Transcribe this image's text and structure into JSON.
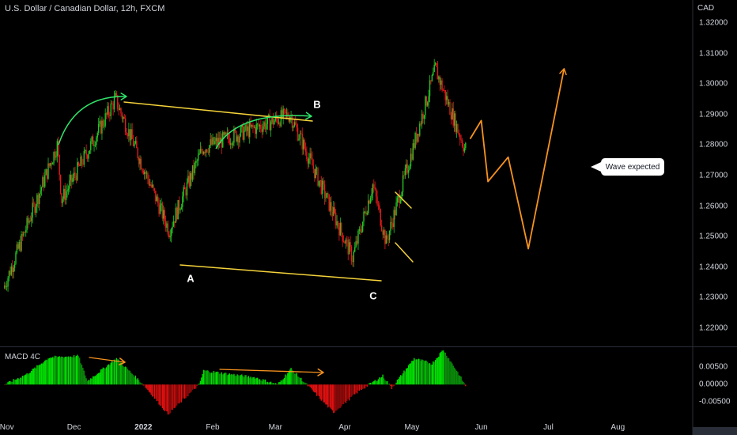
{
  "header": {
    "title": "U.S. Dollar / Canadian Dollar, 12h, FXCM",
    "currency": "CAD"
  },
  "indicator": {
    "title": "MACD 4C"
  },
  "annotations": {
    "a": "A",
    "b": "B",
    "c": "C",
    "callout": "Wave expected"
  },
  "colors": {
    "up": "#26c426",
    "down": "#e51a1a",
    "ann_yellow": "#f5d33a",
    "ann_green": "#2fe56b",
    "ann_orange": "#f7931e",
    "macd_up_bright": "#00e000",
    "macd_up_dark": "#0a8a0a",
    "macd_down_bright": "#e01010",
    "macd_down_dark": "#8a0a0a"
  },
  "chart_data": [
    {
      "type": "candlestick",
      "symbol": "USDCAD",
      "timeframe": "12h",
      "ylim": [
        1.214,
        1.3275
      ],
      "yticks": [
        "1.32000",
        "1.31000",
        "1.30000",
        "1.29000",
        "1.28000",
        "1.27000",
        "1.26000",
        "1.25000",
        "1.24000",
        "1.23000",
        "1.22000"
      ],
      "xticks": [
        "Nov",
        "Dec",
        "2022",
        "Feb",
        "Mar",
        "Apr",
        "May",
        "Jun",
        "Jul",
        "Aug"
      ],
      "xticks_bold": [
        "2022"
      ],
      "key_points": [
        {
          "x": "Oct 31, 2021",
          "y": 1.233
        },
        {
          "x": "Nov 24, 2021",
          "y": 1.28
        },
        {
          "x": "Nov 26, 2021",
          "y": 1.262
        },
        {
          "x": "Dec 20, 2021",
          "y": 1.295
        },
        {
          "x": "Jan 13, 2022",
          "y": 1.252
        },
        {
          "x": "Jan 28, 2022",
          "y": 1.279
        },
        {
          "x": "Mar 8, 2022",
          "y": 1.29
        },
        {
          "x": "Apr 5, 2022",
          "y": 1.243
        },
        {
          "x": "Apr 14, 2022",
          "y": 1.267
        },
        {
          "x": "Apr 20, 2022",
          "y": 1.248
        },
        {
          "x": "May 12, 2022",
          "y": 1.305
        },
        {
          "x": "May 25, 2022",
          "y": 1.279
        }
      ],
      "projection": [
        {
          "x": "May 27, 2022",
          "y": 1.282
        },
        {
          "x": "Jun 1, 2022",
          "y": 1.288
        },
        {
          "x": "Jun 4, 2022",
          "y": 1.268
        },
        {
          "x": "Jun 13, 2022",
          "y": 1.276
        },
        {
          "x": "Jun 22, 2022",
          "y": 1.246
        },
        {
          "x": "Jul 8, 2022",
          "y": 1.305
        }
      ]
    },
    {
      "type": "histogram",
      "name": "MACD 4C",
      "ylim": [
        -0.0095,
        0.0105
      ],
      "yticks": [
        "0.00500",
        "0.00000",
        "-0.00500"
      ],
      "key_points": [
        {
          "x": "Oct 31, 2021",
          "y": 0.0
        },
        {
          "x": "Nov 10, 2021",
          "y": 0.003
        },
        {
          "x": "Nov 20, 2021",
          "y": 0.0078
        },
        {
          "x": "Dec 3, 2021",
          "y": 0.0082
        },
        {
          "x": "Dec 7, 2021",
          "y": 0.001
        },
        {
          "x": "Dec 20, 2021",
          "y": 0.0075
        },
        {
          "x": "Jan 1, 2022",
          "y": 0.0
        },
        {
          "x": "Jan 12, 2022",
          "y": -0.0085
        },
        {
          "x": "Jan 26, 2022",
          "y": 0.0
        },
        {
          "x": "Jan 28, 2022",
          "y": 0.004
        },
        {
          "x": "Feb 20, 2022",
          "y": 0.002
        },
        {
          "x": "Mar 2, 2022",
          "y": 0.0
        },
        {
          "x": "Mar 8, 2022",
          "y": 0.0045
        },
        {
          "x": "Mar 15, 2022",
          "y": 0.0
        },
        {
          "x": "Mar 27, 2022",
          "y": -0.008
        },
        {
          "x": "Apr 7, 2022",
          "y": -0.002
        },
        {
          "x": "Apr 18, 2022",
          "y": 0.0025
        },
        {
          "x": "Apr 22, 2022",
          "y": -0.001
        },
        {
          "x": "May 2, 2022",
          "y": 0.0075
        },
        {
          "x": "May 10, 2022",
          "y": 0.006
        },
        {
          "x": "May 15, 2022",
          "y": 0.01
        },
        {
          "x": "May 22, 2022",
          "y": 0.003
        },
        {
          "x": "May 25, 2022",
          "y": -0.0004
        }
      ]
    }
  ]
}
